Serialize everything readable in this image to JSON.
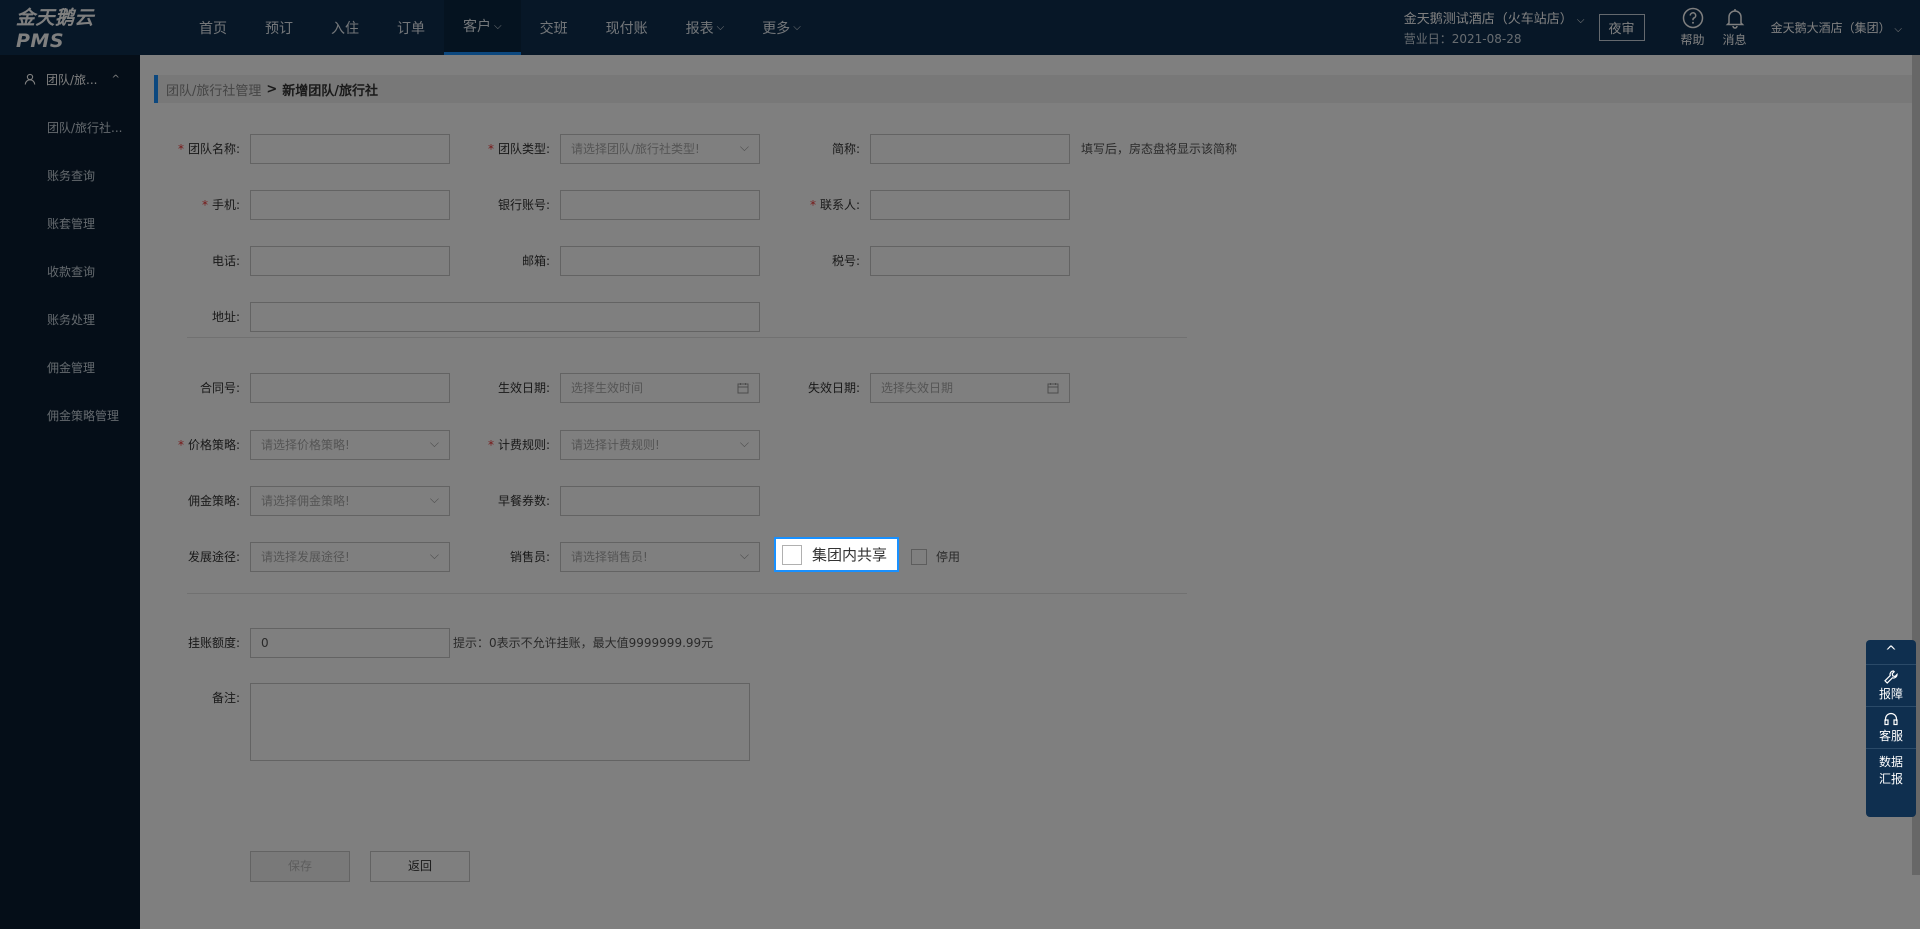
{
  "brand": "金天鹅云PMS",
  "nav": [
    {
      "label": "首页",
      "chev": ""
    },
    {
      "label": "预订",
      "chev": ""
    },
    {
      "label": "入住",
      "chev": ""
    },
    {
      "label": "订单",
      "chev": ""
    },
    {
      "label": "客户",
      "chev": "⌵"
    },
    {
      "label": "交班",
      "chev": ""
    },
    {
      "label": "现付账",
      "chev": ""
    },
    {
      "label": "报表",
      "chev": "⌵"
    },
    {
      "label": "更多",
      "chev": "⌵"
    }
  ],
  "header": {
    "hotel_name": "金天鹅测试酒店（火车站店）",
    "hotel_chev": "⌵",
    "business_date": "营业日：2021-08-28",
    "night_audit": "夜审",
    "help": "帮助",
    "messages": "消息",
    "group": "金天鹅大酒店（集团）",
    "group_chev": "⌵"
  },
  "sidebar": {
    "head": "团队/旅...",
    "caret": "^",
    "items": [
      "团队/旅行社...",
      "账务查询",
      "账套管理",
      "收款查询",
      "账务处理",
      "佣金管理",
      "佣金策略管理"
    ]
  },
  "breadcrumb": {
    "parent": "团队/旅行社管理",
    "sep": ">",
    "current": "新增团队/旅行社"
  },
  "form": {
    "team_name": "团队名称:",
    "team_type": "团队类型:",
    "team_type_ph": "请选择团队/旅行社类型!",
    "short_name": "简称:",
    "short_hint": "填写后，房态盘将显示该简称",
    "mobile": "手机:",
    "bank_account": "银行账号:",
    "contact": "联系人:",
    "phone": "电话:",
    "postcode": "邮箱:",
    "tax_no": "税号:",
    "address": "地址:",
    "contract_no": "合同号:",
    "start_date": "生效日期:",
    "start_date_ph": "选择生效时间",
    "end_date": "失效日期:",
    "end_date_ph": "选择失效日期",
    "price_policy": "价格策略:",
    "price_policy_ph": "请选择价格策略!",
    "billing_rule": "计费规则:",
    "billing_rule_ph": "请选择计费规则!",
    "commission_policy": "佣金策略:",
    "commission_policy_ph": "请选择佣金策略!",
    "breakfast": "早餐券数:",
    "channel": "发展途径:",
    "channel_ph": "请选择发展途径!",
    "sales": "销售员:",
    "sales_ph": "请选择销售员!",
    "share_group": "集团内共享",
    "disable": "停用",
    "credit_limit": "挂账额度:",
    "credit_value": "0",
    "credit_hint": "提示：0表示不允许挂账，最大值9999999.99元",
    "remark": "备注:",
    "save": "保存",
    "back": "返回",
    "required_mark": "*"
  },
  "float_panel": {
    "up": "^",
    "report": "报障",
    "service": "客服",
    "data1": "数据",
    "data2": "汇报"
  },
  "colors": {
    "topbar": "#0f2f4f",
    "sidebar": "#0a1d30",
    "accent": "#1890ff",
    "required": "#e33333"
  }
}
